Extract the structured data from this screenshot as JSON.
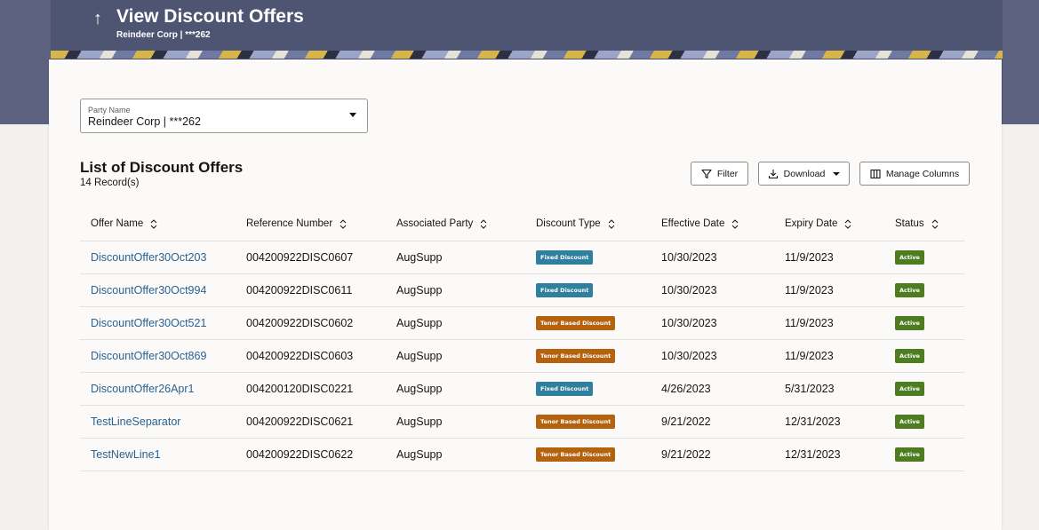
{
  "header": {
    "title": "View Discount Offers",
    "subtitle": "Reindeer Corp | ***262",
    "back_icon": "up-arrow-icon"
  },
  "party": {
    "label": "Party Name",
    "value": "Reindeer Corp | ***262"
  },
  "list": {
    "title": "List of Discount Offers",
    "count": "14 Record(s)"
  },
  "toolbar": {
    "filter_label": "Filter",
    "download_label": "Download",
    "columns_label": "Manage Columns"
  },
  "colors": {
    "banner": "#4d5170",
    "link": "#2a6291",
    "fixed_badge": "#2f7f9e",
    "tenor_badge": "#b5620f",
    "active_badge": "#4e7d21"
  },
  "table": {
    "columns": [
      "Offer Name",
      "Reference Number",
      "Associated Party",
      "Discount Type",
      "Effective Date",
      "Expiry Date",
      "Status"
    ],
    "rows": [
      {
        "offer": "DiscountOffer30Oct203",
        "ref": "004200922DISC0607",
        "party": "AugSupp",
        "type": "Fixed Discount",
        "kind": "fixed",
        "effective": "10/30/2023",
        "expiry": "11/9/2023",
        "status": "Active"
      },
      {
        "offer": "DiscountOffer30Oct994",
        "ref": "004200922DISC0611",
        "party": "AugSupp",
        "type": "Fixed Discount",
        "kind": "fixed",
        "effective": "10/30/2023",
        "expiry": "11/9/2023",
        "status": "Active"
      },
      {
        "offer": "DiscountOffer30Oct521",
        "ref": "004200922DISC0602",
        "party": "AugSupp",
        "type": "Tenor Based Discount",
        "kind": "tenor",
        "effective": "10/30/2023",
        "expiry": "11/9/2023",
        "status": "Active"
      },
      {
        "offer": "DiscountOffer30Oct869",
        "ref": "004200922DISC0603",
        "party": "AugSupp",
        "type": "Tenor Based Discount",
        "kind": "tenor",
        "effective": "10/30/2023",
        "expiry": "11/9/2023",
        "status": "Active"
      },
      {
        "offer": "DiscountOffer26Apr1",
        "ref": "004200120DISC0221",
        "party": "AugSupp",
        "type": "Fixed Discount",
        "kind": "fixed",
        "effective": "4/26/2023",
        "expiry": "5/31/2023",
        "status": "Active"
      },
      {
        "offer": "TestLineSeparator",
        "ref": "004200922DISC0621",
        "party": "AugSupp",
        "type": "Tenor Based Discount",
        "kind": "tenor",
        "effective": "9/21/2022",
        "expiry": "12/31/2023",
        "status": "Active"
      },
      {
        "offer": "TestNewLine1",
        "ref": "004200922DISC0622",
        "party": "AugSupp",
        "type": "Tenor Based Discount",
        "kind": "tenor",
        "effective": "9/21/2022",
        "expiry": "12/31/2023",
        "status": "Active"
      }
    ]
  }
}
